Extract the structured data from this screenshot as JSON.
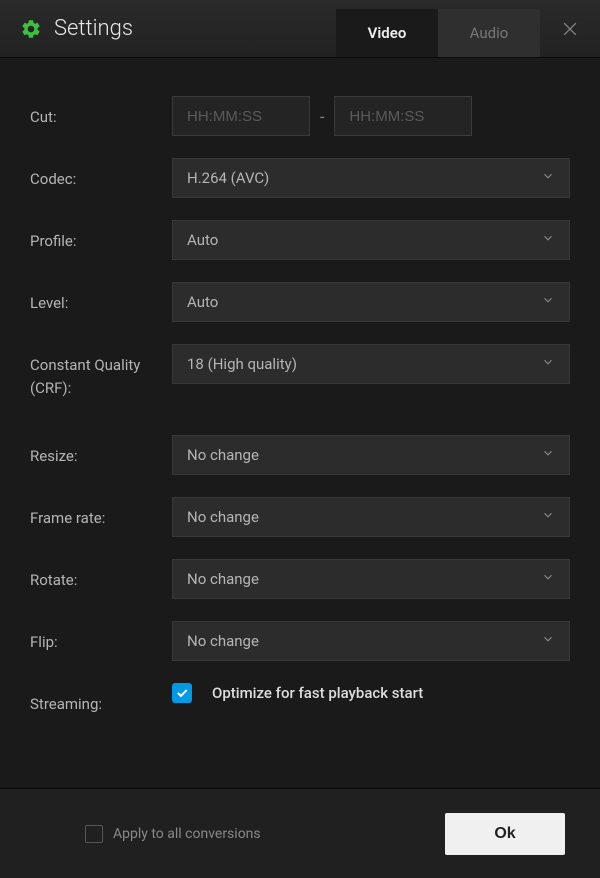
{
  "header": {
    "title": "Settings",
    "tabs": {
      "video": "Video",
      "audio": "Audio"
    }
  },
  "form": {
    "cut": {
      "label": "Cut:",
      "start_placeholder": "HH:MM:SS",
      "end_placeholder": "HH:MM:SS",
      "separator": "-"
    },
    "codec": {
      "label": "Codec:",
      "value": "H.264 (AVC)"
    },
    "profile": {
      "label": "Profile:",
      "value": "Auto"
    },
    "level": {
      "label": "Level:",
      "value": "Auto"
    },
    "crf": {
      "label": "Constant Quality (CRF):",
      "value": "18 (High quality)"
    },
    "resize": {
      "label": "Resize:",
      "value": "No change"
    },
    "framerate": {
      "label": "Frame rate:",
      "value": "No change"
    },
    "rotate": {
      "label": "Rotate:",
      "value": "No change"
    },
    "flip": {
      "label": "Flip:",
      "value": "No change"
    },
    "streaming": {
      "label": "Streaming:",
      "checkbox_label": "Optimize for fast playback start",
      "checked": true
    }
  },
  "footer": {
    "apply_all": "Apply to all conversions",
    "ok": "Ok"
  }
}
